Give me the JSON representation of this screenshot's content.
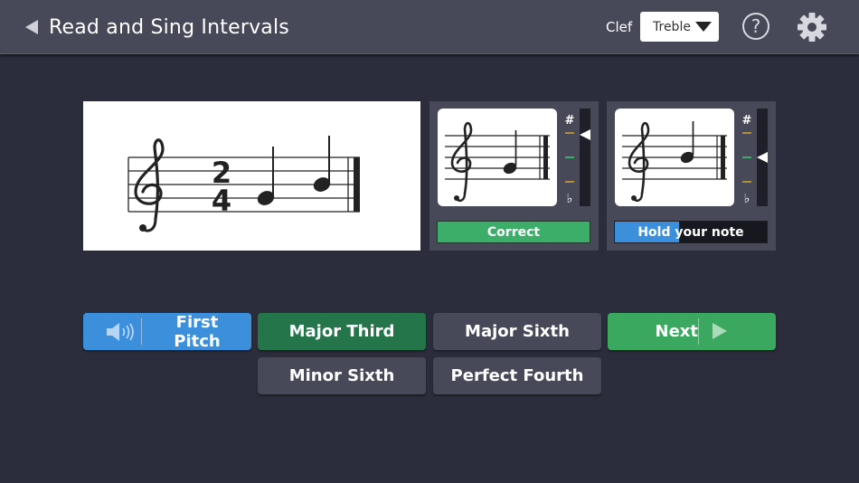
{
  "header": {
    "title": "Read and Sing Intervals",
    "clef_label": "Clef",
    "clef_value": "Treble",
    "help_label": "?"
  },
  "staff": {
    "time_signature_top": "2",
    "time_signature_bottom": "4"
  },
  "pitch_panels": [
    {
      "status": "Correct",
      "meter_sharp": "#",
      "meter_flat": "♭",
      "meter_level": 0.27
    },
    {
      "status": "Hold your note",
      "meter_sharp": "#",
      "meter_flat": "♭",
      "meter_level": 0.5,
      "hold_progress": 0.42
    }
  ],
  "buttons": {
    "first_pitch": "First Pitch",
    "answers": [
      "Major Third",
      "Major Sixth",
      "Minor Sixth",
      "Perfect Fourth"
    ],
    "next": "Next"
  },
  "colors": {
    "background": "#2b2d3c",
    "topbar": "#474858",
    "correct_green": "#3dad6a",
    "selected_green": "#24764a",
    "next_green": "#3aa85f",
    "blue": "#3b8fdb",
    "meter_sharp_mark": "#d7a531",
    "meter_target_mark": "#3dad6a"
  },
  "icons": {
    "back": "back-triangle-icon",
    "dropdown": "chevron-down-icon",
    "help": "help-circle-icon",
    "settings": "gear-icon",
    "speaker": "speaker-icon",
    "next": "play-arrow-icon"
  }
}
